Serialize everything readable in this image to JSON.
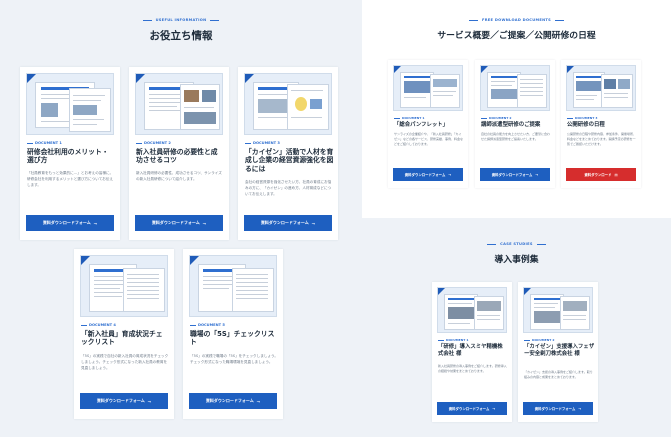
{
  "useful": {
    "eyebrow": "USEFUL INFORMATION",
    "title": "お役立ち情報",
    "cards": [
      {
        "doc": "DOCUMENT 1",
        "title": "研修会社利用のメリット・選び方",
        "desc": "「社員教育をもっと効果的に…」とお考えの皆様に。研修会社を利用するメリットと選び方についてお伝えします。",
        "button": "資料ダウンロードフォーム"
      },
      {
        "doc": "DOCUMENT 2",
        "title": "新入社員研修の必要性と成功させるコツ",
        "desc": "新入社員研修の必要性、成功させるコツ、サンライズの新入社員研修について紹介します。",
        "button": "資料ダウンロードフォーム"
      },
      {
        "doc": "DOCUMENT 3",
        "title": "「カイゼン」活動で人材を育成し企業の経営資源強化を図るには",
        "desc": "会社の経営資源を強化させたい方、社員の育成にお悩みの方に、「カイゼン」の進め方、人材育成などについてお伝えします。",
        "button": "資料ダウンロードフォーム"
      },
      {
        "doc": "DOCUMENT 4",
        "title": "「新入社員」育成状況チェックリスト",
        "desc": "「5S」の実践で自社の新入社員の育成状況をチェックしましょう。チェック形式になった新入社員の教育を見直しましょう。",
        "button": "資料ダウンロードフォーム"
      },
      {
        "doc": "DOCUMENT 5",
        "title": "職場の「5S」チェックリスト",
        "desc": "「5S」の実践で職場の「5S」をチェックしましょう。チェック形式になった職場環境を見直しましょう。",
        "button": "資料ダウンロードフォーム"
      }
    ]
  },
  "free": {
    "eyebrow": "FREE DOWNLOAD DOCUMENTS",
    "title": "サービス概要／ご提案／公開研修の日程",
    "cards": [
      {
        "doc": "DOCUMENT 1",
        "title": "「総合パンフレット」",
        "desc": "サンライズの企業紹介や、「新入社員研修」「カイゼン」などの各サービス、研修実績、事例、料金などをご紹介しております。",
        "button": "資料ダウンロードフォーム"
      },
      {
        "doc": "DOCUMENT 2",
        "title": "講師派遣型研修のご提案",
        "desc": "自社の社員の能力を向上させたい方、ご要望に合わせた講師派遣型研修をご提案いたします。",
        "button": "資料ダウンロードフォーム"
      },
      {
        "doc": "DOCUMENT 3",
        "title": "公開研修の日程",
        "desc": "公開研修の日程や研修内容、参加条件、開催場所、料金などをまとめております。開講予定の研修を一覧でご確認いただけます。",
        "button": "資料ダウンロード"
      }
    ]
  },
  "cases": {
    "eyebrow": "CASE STUDIES",
    "title": "導入事例集",
    "cards": [
      {
        "doc": "DOCUMENT 1",
        "title": "「研修」導入スミヤ精機株式会社 様",
        "desc": "新入社員研修の導入事例をご紹介します。研修導入の経緯や効果をまとめております。",
        "button": "資料ダウンロードフォーム"
      },
      {
        "doc": "DOCUMENT 2",
        "title": "「カイゼン」支援導入フェザー安全剃刀株式会社 様",
        "desc": "「カイゼン」支援の導入事例をご紹介します。取り組みの内容と成果をまとめております。",
        "button": "資料ダウンロードフォーム"
      }
    ]
  },
  "icons": {
    "arrow": "arrow-right-icon",
    "pdf": "pdf-icon",
    "corner": "corner-triangle-icon"
  },
  "colors": {
    "primary": "#1e5fc0",
    "accent": "#d62d2d",
    "text": "#1d2b3a",
    "muted": "#6e7a88"
  }
}
